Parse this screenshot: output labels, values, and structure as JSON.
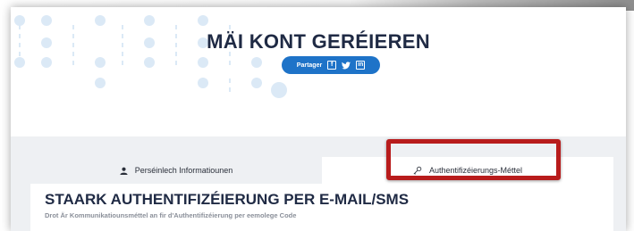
{
  "hero": {
    "title": "MÄI KONT GERÉIEREN",
    "share_label": "Partager",
    "social_icons": [
      "facebook-icon",
      "twitter-icon",
      "linkedin-icon"
    ],
    "facebook_glyph": "f",
    "linkedin_glyph": "in"
  },
  "tabs": [
    {
      "label": "Perséinlech Informatiounen",
      "icon": "person-icon",
      "active": false
    },
    {
      "label": "Authentifizéierungs-Méttel",
      "icon": "key-icon",
      "active": true
    }
  ],
  "card": {
    "title": "STAARK AUTHENTIFIZÉIERUNG PER E-MAIL/SMS",
    "subtitle": "Drot Är Kommunikatiounsméttel an fir d'Authentifizéierung per eemolege Code"
  },
  "colors": {
    "accent": "#1e73c8",
    "highlight": "#b81c1c",
    "title": "#1f2a44",
    "deco_dots": "#dbe9f6"
  }
}
